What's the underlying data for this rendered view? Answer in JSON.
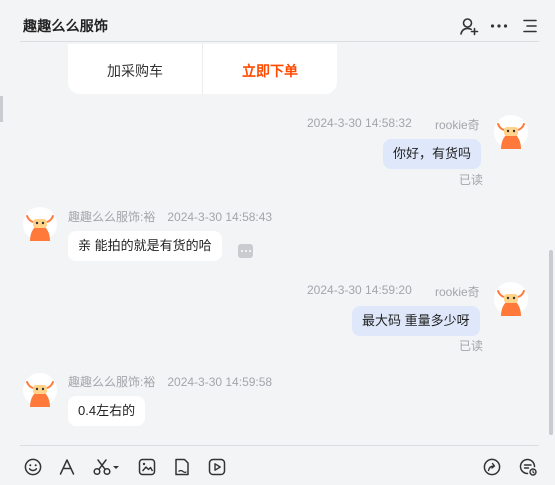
{
  "header": {
    "title": "趣趣么么服饰"
  },
  "order_card": {
    "add_label": "加采购车",
    "buy_label": "立即下单"
  },
  "messages": [
    {
      "direction": "out",
      "sender": "rookie奇",
      "time": "2024-3-30 14:58:32",
      "text": "你好，有货吗",
      "status": "已读"
    },
    {
      "direction": "in",
      "sender": "趣趣么么服饰:裕",
      "time": "2024-3-30 14:58:43",
      "text": "亲 能拍的就是有货的哈"
    },
    {
      "direction": "out",
      "sender": "rookie奇",
      "time": "2024-3-30 14:59:20",
      "text": "最大码 重量多少呀",
      "status": "已读"
    },
    {
      "direction": "in",
      "sender": "趣趣么么服饰:裕",
      "time": "2024-3-30 14:59:58",
      "text": "0.4左右的"
    }
  ],
  "icons": {
    "header": [
      "add-contact-icon",
      "more-icon",
      "menu-icon"
    ],
    "toolbar": [
      "emoji-icon",
      "font-icon",
      "scissors-icon",
      "image-icon",
      "file-icon",
      "video-icon",
      "share-icon",
      "quick-reply-icon"
    ]
  },
  "colors": {
    "accent": "#ff4a00",
    "outgoing_bubble": "#dfe8fb",
    "background": "#f3f4f6"
  }
}
